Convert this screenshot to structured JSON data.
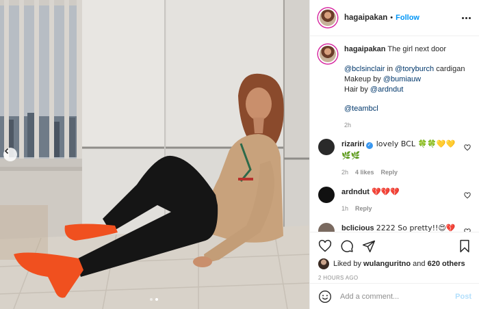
{
  "post": {
    "username": "hagaipakan",
    "follow_label": "Follow",
    "separator": "•"
  },
  "caption": {
    "username": "hagaipakan",
    "text": "The girl next door",
    "line1_mention1": "@bclsinclair",
    "line1_mid": " in ",
    "line1_mention2": "@toryburch",
    "line1_end": " cardigan",
    "line2_pre": "Makeup by ",
    "line2_mention": "@bumiauw",
    "line3_pre": "Hair by ",
    "line3_mention": "@ardndut",
    "tag": "@teambcl",
    "time": "2h"
  },
  "comments": [
    {
      "username": "rizariri",
      "verified": true,
      "text": "lovely BCL 🍀🍀💛💛 🌿🌿",
      "time": "2h",
      "likes": "4 likes",
      "reply": "Reply",
      "avatar_color": "#2a2a2a"
    },
    {
      "username": "ardndut",
      "text": "💔💔💔",
      "time": "1h",
      "reply": "Reply",
      "avatar_color": "#111111"
    },
    {
      "username": "bclicious",
      "text": "2222 So pretty!!😍💔",
      "avatar_color": "#7a6a60"
    }
  ],
  "likes": {
    "prefix": "Liked by",
    "user": "wulanguritno",
    "middle": "and",
    "others": "620 others"
  },
  "timestamp": "2 HOURS AGO",
  "composer": {
    "placeholder": "Add a comment...",
    "post_label": "Post"
  },
  "carousel": {
    "total": 2,
    "active_index": 1
  },
  "colors": {
    "link": "#0095f6",
    "mention": "#00376b",
    "muted": "#8e8e8e",
    "shoe": "#f0501f"
  }
}
